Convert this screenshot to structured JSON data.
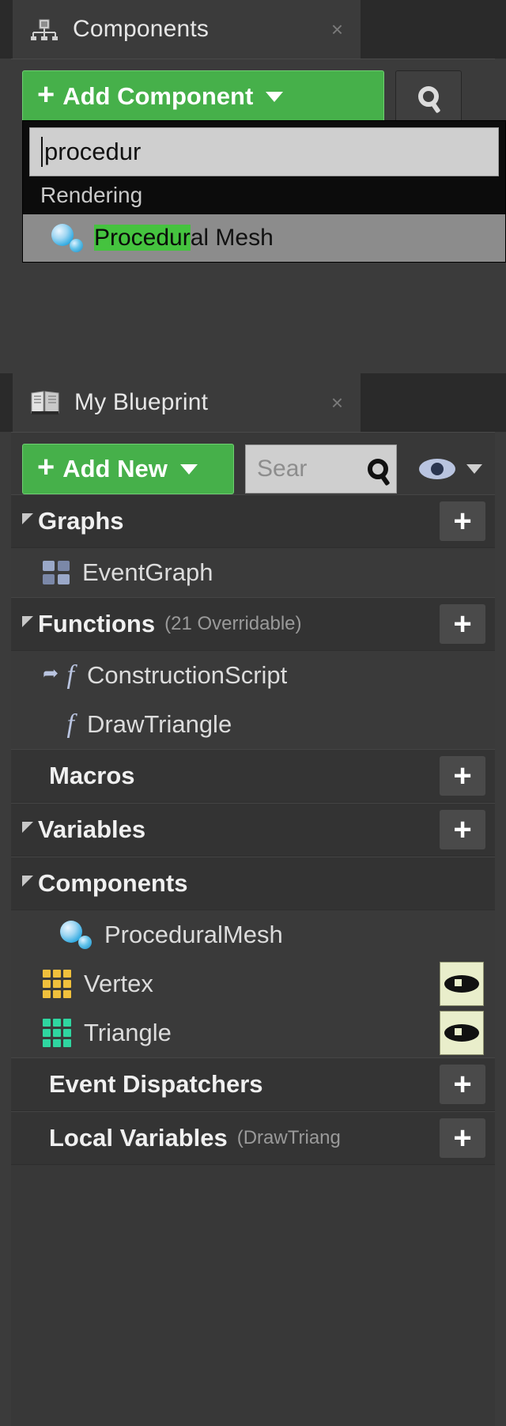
{
  "components_panel": {
    "tab_label": "Components",
    "tab_icon": "components-icon",
    "close_label": "×",
    "add_component_button": "Add Component",
    "add_component_plus": "+",
    "search_icon_name": "search-icon",
    "search_popup": {
      "input_value": "procedur",
      "category": "Rendering",
      "results": [
        {
          "match": "Procedur",
          "rest": "al Mesh",
          "icon": "procedural-mesh-icon"
        }
      ]
    }
  },
  "myblueprint_panel": {
    "tab_label": "My Blueprint",
    "tab_icon": "blueprint-book-icon",
    "close_label": "×",
    "toolbar": {
      "add_new_button": "Add New",
      "add_new_plus": "+",
      "search_placeholder": "Sear",
      "search_icon_name": "search-icon",
      "visibility_icon_name": "eye-icon"
    },
    "sections": [
      {
        "name": "graphs",
        "title": "Graphs",
        "subtitle": "",
        "collapsible": true,
        "add_label": "+",
        "items": [
          {
            "label": "EventGraph",
            "icon": "event-graph-icon",
            "indent": 1,
            "eye": false
          }
        ]
      },
      {
        "name": "functions",
        "title": "Functions",
        "subtitle": "(21 Overridable)",
        "collapsible": true,
        "add_label": "+",
        "items": [
          {
            "label": "ConstructionScript",
            "icon": "construction-script-icon",
            "indent": 1,
            "eye": false
          },
          {
            "label": "DrawTriangle",
            "icon": "function-icon",
            "indent": 1,
            "eye": false
          }
        ]
      },
      {
        "name": "macros",
        "title": "Macros",
        "subtitle": "",
        "collapsible": false,
        "add_label": "+",
        "items": []
      },
      {
        "name": "variables",
        "title": "Variables",
        "subtitle": "",
        "collapsible": true,
        "add_label": "+",
        "items": []
      },
      {
        "name": "components",
        "title": "Components",
        "subtitle": "",
        "collapsible": true,
        "add_label": "",
        "items": [
          {
            "label": "ProceduralMesh",
            "icon": "procedural-mesh-icon",
            "indent": 2,
            "eye": false
          },
          {
            "label": "Vertex",
            "icon": "array-icon-gold",
            "indent": 1,
            "eye": true
          },
          {
            "label": "Triangle",
            "icon": "array-icon-teal",
            "indent": 1,
            "eye": true
          }
        ]
      },
      {
        "name": "event-dispatchers",
        "title": "Event Dispatchers",
        "subtitle": "",
        "collapsible": false,
        "add_label": "+",
        "items": []
      },
      {
        "name": "local-variables",
        "title": "Local Variables",
        "subtitle": "(DrawTriang",
        "collapsible": false,
        "add_label": "+",
        "items": []
      }
    ]
  },
  "colors": {
    "accent_green": "#46b04a",
    "highlight_green": "#45c33f",
    "panel_bg": "#3b3b3b",
    "array_gold": "#f0c03c",
    "array_teal": "#2fd6a0"
  }
}
